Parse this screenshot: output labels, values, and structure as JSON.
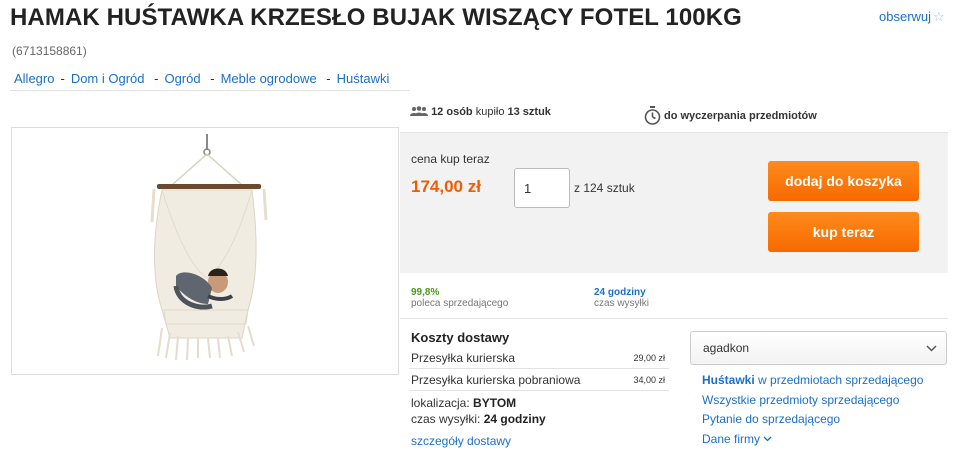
{
  "header": {
    "title": "HAMAK HUŚTAWKA KRZESŁO BUJAK WISZĄCY FOTEL 100KG",
    "watch_label": "obserwuj",
    "offer_id": "(6713158861)"
  },
  "breadcrumb": [
    "Allegro",
    "Dom i Ogród",
    "Ogród",
    "Meble ogrodowe",
    "Huśtawki"
  ],
  "stats": {
    "buyers_count": "12 osób",
    "bought_text": "kupiło",
    "items_count": "13 sztuk",
    "time_text": "do wyczerpania przedmiotów"
  },
  "purchase": {
    "price_label": "cena kup teraz",
    "price": "174,00 zł",
    "quantity": "1",
    "available": "z 124 sztuk",
    "cart_button": "dodaj do koszyka",
    "buy_button": "kup teraz"
  },
  "seller_stats": {
    "rating": "99,8%",
    "rating_label": "poleca sprzedającego",
    "shipping_time": "24 godziny",
    "shipping_time_label": "czas wysyłki"
  },
  "delivery": {
    "title": "Koszty dostawy",
    "options": [
      {
        "name": "Przesyłka kurierska",
        "price": "29,00 zł"
      },
      {
        "name": "Przesyłka kurierska pobraniowa",
        "price": "34,00 zł"
      }
    ],
    "location_label": "lokalizacja:",
    "location": "BYTOM",
    "dispatch_label": "czas wysyłki:",
    "dispatch": "24 godziny",
    "details_link": "szczegóły dostawy"
  },
  "seller": {
    "name": "agadkon",
    "category_link_bold": "Huśtawki",
    "category_link_rest": "w przedmiotach sprzedającego",
    "all_items": "Wszystkie przedmioty sprzedającego",
    "ask": "Pytanie do sprzedającego",
    "company": "Dane firmy"
  },
  "icons": {
    "watch": "star-icon",
    "buyers": "people-icon",
    "timer": "stopwatch-icon",
    "select": "chevron-down-icon"
  },
  "colors": {
    "accent_orange": "#f66a00",
    "price": "#f25c00",
    "link": "#1a6fc9",
    "rating_green": "#4c9a1c"
  }
}
